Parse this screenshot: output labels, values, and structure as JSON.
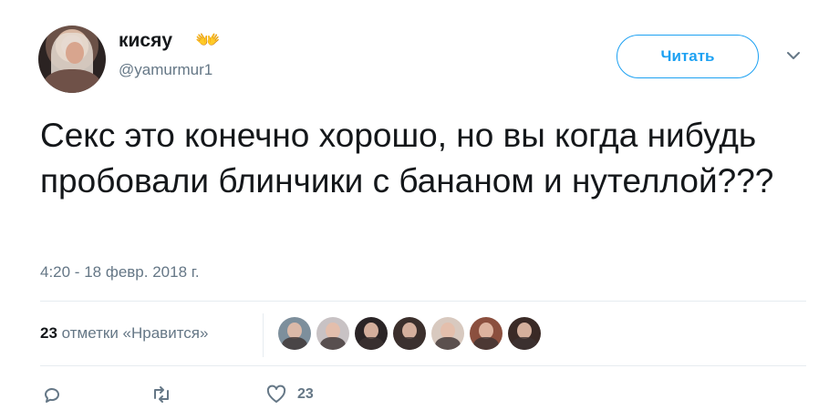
{
  "user": {
    "display_name": "кисяу",
    "name_emoji": "👐",
    "handle": "@yamurmur1"
  },
  "follow_button": {
    "label": "Читать"
  },
  "tweet": {
    "text": "Секс это конечно хорошо, но вы когда нибудь пробовали блинчики с бананом и нутеллой???",
    "timestamp": "4:20 - 18 февр. 2018 г."
  },
  "stats": {
    "likes_count": "23",
    "likes_label": "отметки «Нравится»"
  },
  "likers": [
    {
      "bg": "#7d8f9c"
    },
    {
      "bg": "#c8c2c4"
    },
    {
      "bg": "#2a2426"
    },
    {
      "bg": "#3b2f2c"
    },
    {
      "bg": "#d8c9bf"
    },
    {
      "bg": "#8b4f3e"
    },
    {
      "bg": "#3a2a26"
    }
  ],
  "actions": {
    "like_count": "23"
  },
  "colors": {
    "accent": "#1da1f2",
    "secondary_text": "#657786",
    "divider": "#e6ecf0"
  }
}
